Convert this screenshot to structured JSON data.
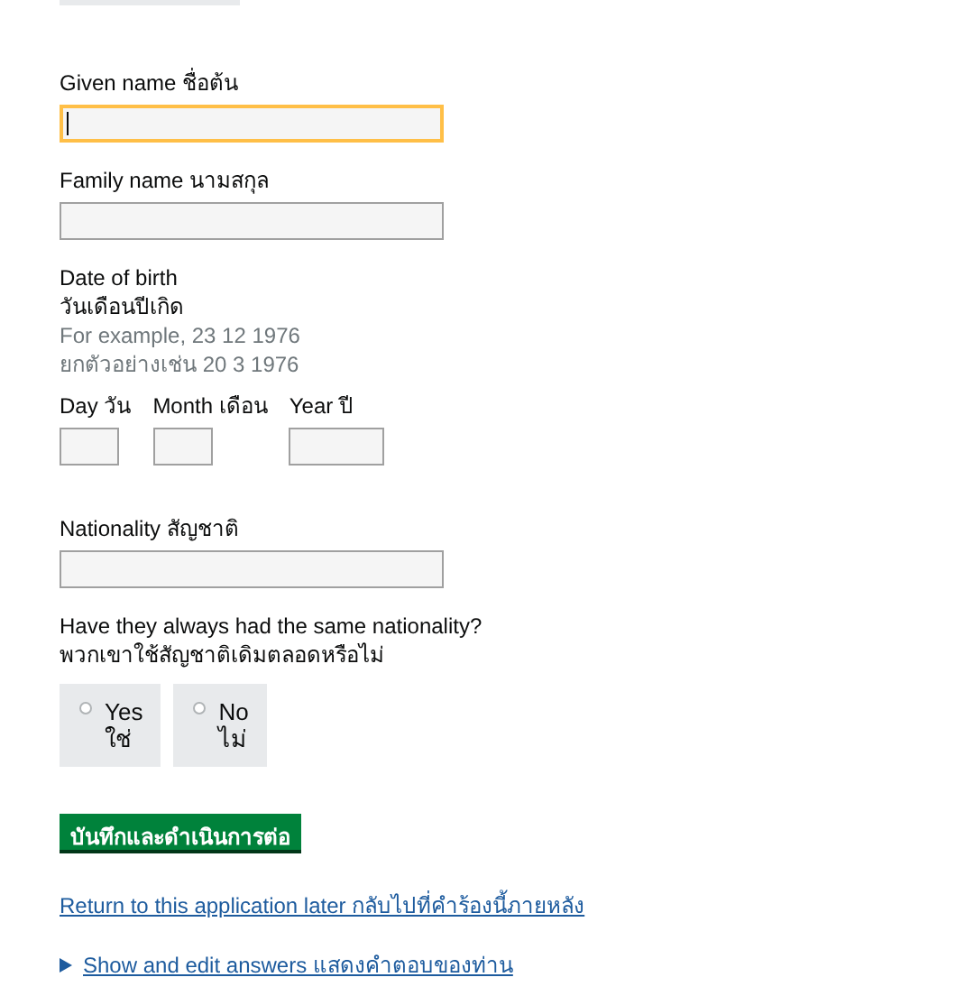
{
  "fields": [
    {
      "kind": "text",
      "label": "Given name ชื่อต้น",
      "focused": true
    },
    {
      "kind": "text",
      "label": "Family name นามสกุล",
      "focused": false
    },
    {
      "kind": "date",
      "label": "Date of birth",
      "label_2": "วันเดือนปีเกิด",
      "hint": "For example, 23 12 1976",
      "hint_2": "ยกตัวอย่างเช่น 20 3 1976",
      "parts": [
        {
          "label": "Day วัน",
          "kind": "short"
        },
        {
          "label": "Month เดือน",
          "kind": "short"
        },
        {
          "label": "Year ปี",
          "kind": "long"
        }
      ]
    },
    {
      "kind": "text",
      "label": "Nationality สัญชาติ",
      "focused": false
    },
    {
      "kind": "radio",
      "label": "Have they always had the same nationality?",
      "label_2": "พวกเขาใช้สัญชาติเดิมตลอดหรือไม่",
      "options": [
        {
          "label": "Yes",
          "label_2": "ใช่",
          "selected": false
        },
        {
          "label": "No",
          "label_2": "ไม่",
          "selected": false
        }
      ]
    }
  ],
  "submit": "บันทึกและดำเนินการต่อ",
  "return_link": "Return to this application later กลับไปที่คำร้องนี้ภายหลัง",
  "details": {
    "summary": "Show and edit answers แสดงคำตอบของท่าน",
    "expanded": false
  }
}
